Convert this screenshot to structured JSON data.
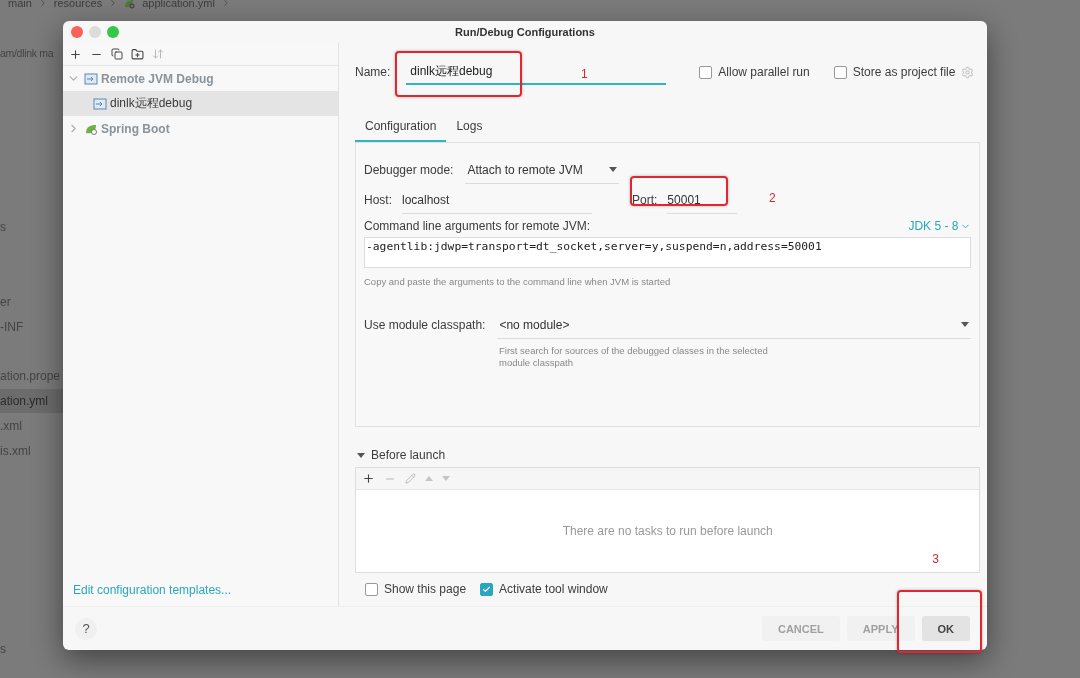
{
  "background": {
    "breadcrumb": [
      "main",
      "resources",
      "application.yml"
    ],
    "path_fragment": "am/dlink ma",
    "files": [
      {
        "label": "s",
        "selected": false
      },
      {
        "label": "er",
        "selected": false
      },
      {
        "label": "-INF",
        "selected": false
      },
      {
        "label": "ation.prope",
        "selected": false
      },
      {
        "label": "ation.yml",
        "selected": true
      },
      {
        "label": ".xml",
        "selected": false
      },
      {
        "label": "is.xml",
        "selected": false
      },
      {
        "label": "s",
        "selected": false
      }
    ]
  },
  "window": {
    "title": "Run/Debug Configurations"
  },
  "sidebar": {
    "tree": [
      {
        "label": "Remote JVM Debug",
        "kind": "remote",
        "expanded": true,
        "selected": false,
        "children": [
          {
            "label": "dinlk远程debug",
            "kind": "remote",
            "selected": true
          }
        ]
      },
      {
        "label": "Spring Boot",
        "kind": "spring",
        "expanded": false,
        "selected": false
      }
    ],
    "footer_link": "Edit configuration templates...",
    "help": "?"
  },
  "name_field": {
    "label": "Name:",
    "value": "dinlk远程debug"
  },
  "options": [
    {
      "label": "Allow parallel run",
      "checked": false
    },
    {
      "label": "Store as project file",
      "checked": false
    }
  ],
  "tabs": [
    {
      "label": "Configuration",
      "selected": true
    },
    {
      "label": "Logs",
      "selected": false
    }
  ],
  "configuration": {
    "debugger_mode": {
      "label": "Debugger mode:",
      "value": "Attach to remote JVM"
    },
    "host": {
      "label": "Host:",
      "value": "localhost"
    },
    "port": {
      "label": "Port:",
      "value": "50001"
    },
    "command_line": {
      "label": "Command line arguments for remote JVM:",
      "jdk_selector": "JDK 5 - 8",
      "value": "-agentlib:jdwp=transport=dt_socket,server=y,suspend=n,address=50001",
      "hint": "Copy and paste the arguments to the command line when JVM is started"
    },
    "module_classpath": {
      "label": "Use module classpath:",
      "value": "<no module>",
      "hint": "First search for sources of the debugged classes in the selected module classpath"
    }
  },
  "before_launch": {
    "title": "Before launch",
    "expanded": true,
    "empty_text": "There are no tasks to run before launch"
  },
  "launch_options": [
    {
      "label": "Show this page",
      "checked": false
    },
    {
      "label": "Activate tool window",
      "checked": true
    }
  ],
  "buttons": [
    {
      "label": "CANCEL",
      "kind": "secondary"
    },
    {
      "label": "APPLY",
      "kind": "secondary"
    },
    {
      "label": "OK",
      "kind": "primary"
    }
  ],
  "annotations": [
    {
      "label": "1"
    },
    {
      "label": "2"
    },
    {
      "label": "3"
    }
  ]
}
